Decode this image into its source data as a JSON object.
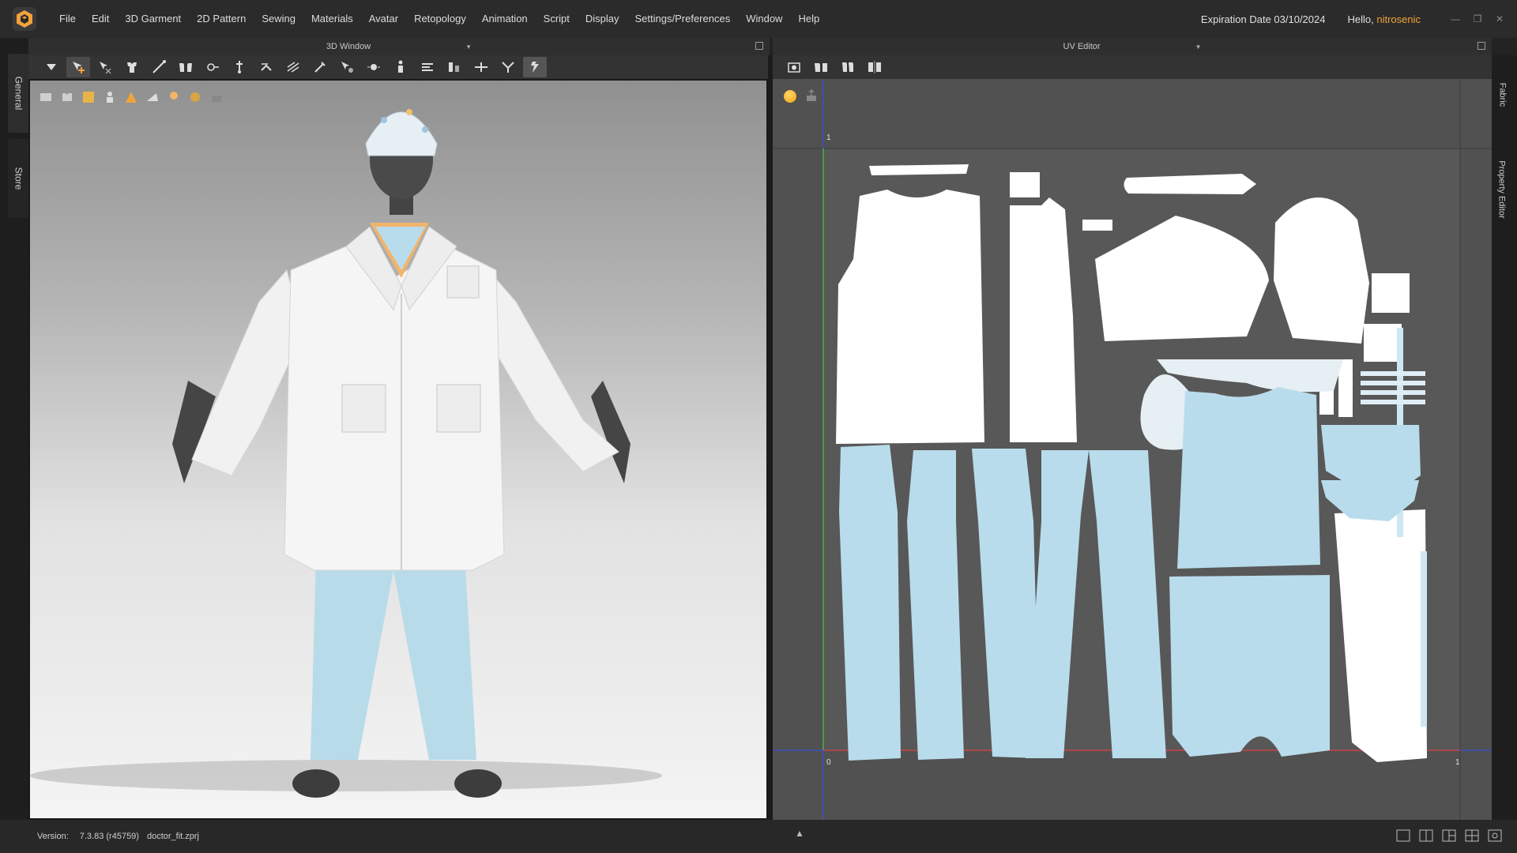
{
  "menubar": {
    "items": [
      "File",
      "Edit",
      "3D Garment",
      "2D Pattern",
      "Sewing",
      "Materials",
      "Avatar",
      "Retopology",
      "Animation",
      "Script",
      "Display",
      "Settings/Preferences",
      "Window",
      "Help"
    ],
    "expiration": "Expiration Date 03/10/2024",
    "hello": "Hello,",
    "username": "nitrosenic"
  },
  "side_tabs": {
    "general": "General",
    "store": "Store"
  },
  "panels": {
    "window_3d_title": "3D Window",
    "uv_editor_title": "UV Editor"
  },
  "right_tabs": {
    "fabric": "Fabric",
    "property_editor": "Property Editor"
  },
  "uv": {
    "origin_label": "0",
    "top_one_label": "1",
    "right_one_label": "1"
  },
  "status": {
    "version_label": "Version:",
    "version": "7.3.83 (r45759)",
    "file": "doctor_fit.zprj"
  },
  "colors": {
    "accent": "#f2a43a",
    "lab_coat": "#f4f4f4",
    "scrubs": "#b9dcec",
    "avatar": "#4a4a4a",
    "uv_bg": "#515151"
  }
}
